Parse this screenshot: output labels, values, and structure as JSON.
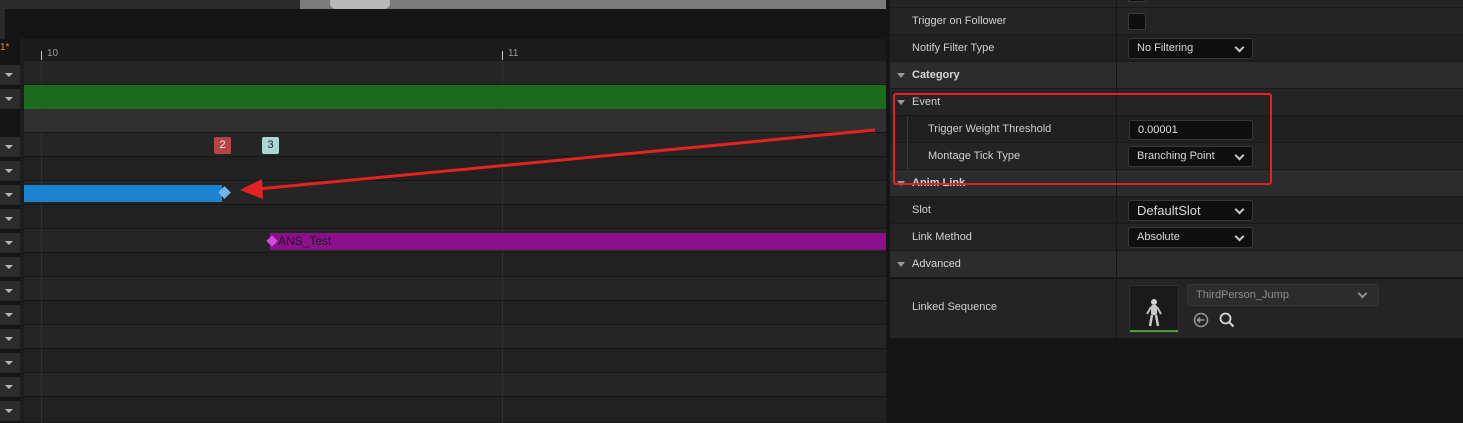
{
  "timeline": {
    "frame_marker": "1*",
    "ruler": {
      "labels": [
        "10",
        "11"
      ]
    },
    "notifies": {
      "badge_2": "2",
      "badge_3": "3"
    },
    "anim_notify_state": {
      "label": "ANS_Test"
    },
    "colors": {
      "section": "#1a6b1c",
      "branch_point": "#1a82cf",
      "notify_state": "#8c0f8c",
      "annotation_arrow": "#e52222"
    }
  },
  "details": {
    "rows": {
      "trigger_on_follower": {
        "label": "Trigger on Follower",
        "checked": false
      },
      "notify_filter_type": {
        "label": "Notify Filter Type",
        "value": "No Filtering"
      }
    },
    "category": {
      "label": "Category",
      "event": {
        "label": "Event",
        "trigger_weight_threshold": {
          "label": "Trigger Weight Threshold",
          "value": "0.00001"
        },
        "montage_tick_type": {
          "label": "Montage Tick Type",
          "value": "Branching Point"
        }
      }
    },
    "anim_link": {
      "label": "Anim Link",
      "slot": {
        "label": "Slot",
        "value": "DefaultSlot"
      },
      "link_method": {
        "label": "Link Method",
        "value": "Absolute"
      }
    },
    "advanced": {
      "label": "Advanced",
      "linked_sequence": {
        "label": "Linked Sequence",
        "value": "ThirdPerson_Jump",
        "icons": [
          "browse-back-icon",
          "search-icon"
        ]
      }
    }
  }
}
